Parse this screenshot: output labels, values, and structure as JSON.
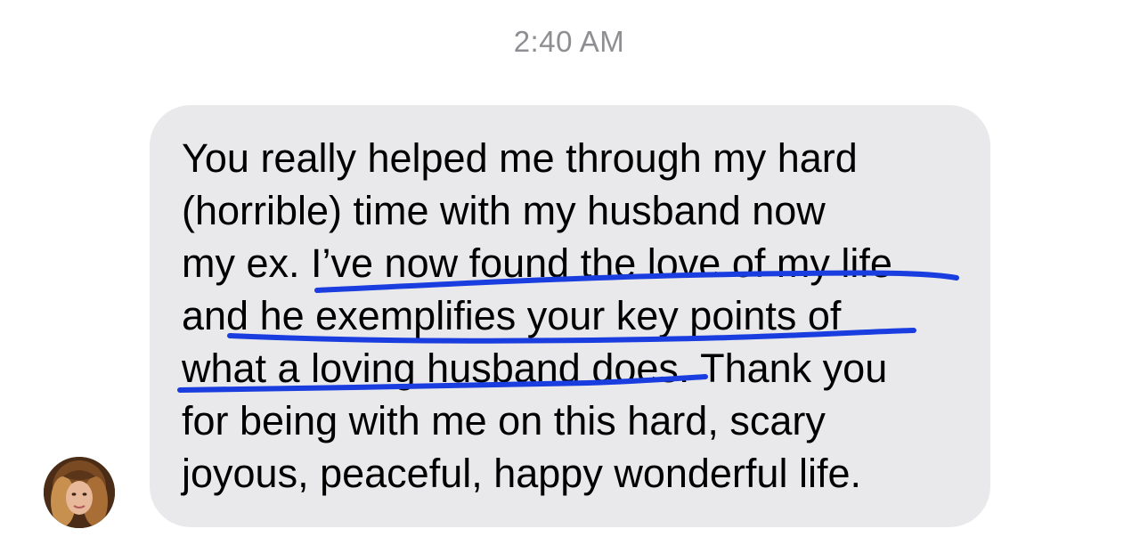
{
  "conversation": {
    "timestamp": "2:40 AM",
    "message": {
      "lines": [
        "You really helped me through my hard",
        "(horrible) time with my husband now",
        "my ex. I’ve now found the love of my life",
        "and he exemplifies your key points of",
        "what a loving husband does. Thank you",
        "for being with me on this hard, scary",
        "joyous, peaceful, happy wonderful life."
      ]
    },
    "sender_avatar": "contact-photo",
    "highlight_color": "#1a3de0"
  }
}
